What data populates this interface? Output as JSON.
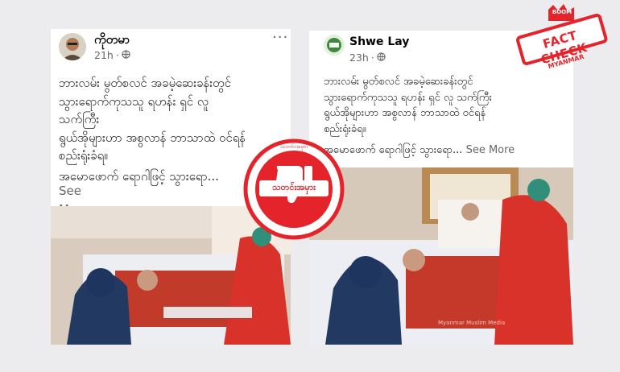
{
  "left_post": {
    "author": "ကိုတမာ",
    "time": "21h",
    "menu_icon": "more-dots-icon",
    "privacy_icon": "globe-icon",
    "text_lines": "ဘားလမ်း မွတ်စလင် အခမဲ့ဆေးခန်းတွင်\nသွားရောက်ကုသသူ ရဟန်း ရှင် လူ\nသက်ကြီး\nရွယ်အိုများဟာ အစွလာန် ဘာသာထဲ ဝင်ရန်\nစည်းရုံးခံရ။",
    "second_para": "အမောဖောက် ရောဂါဖြင့် သွားရော...",
    "see_more": "See\nMore"
  },
  "right_post": {
    "author": "Shwe Lay",
    "time": "23h",
    "privacy_icon": "globe-icon",
    "text_lines": "ဘားလမ်း မွတ်စလင် အခမဲ့ဆေးခန်းတွင်\nသွားရောက်ကုသသူ ရဟန်း ရှင် လူ သက်ကြီး\nရွယ်အိုများဟာ အစွလာန် ဘာသာထဲ ဝင်ရန်\nစည်းရုံးခံရ။",
    "second_para": "အမောဖောက် ရောဂါဖြင့် သွားရော...",
    "see_more": "See More",
    "photo_watermark": "Myanmar Muslim Media"
  },
  "stamp": {
    "label": "သတင်းအမှား",
    "ring_text": "သတင်းအမှား",
    "color": "#e4232b",
    "icon": "thumbs-down-icon"
  },
  "badge": {
    "top": "BOOM",
    "main": "FACT CHECK",
    "bottom": "MYANMAR",
    "color": "#e4232b"
  },
  "colors": {
    "background": "#ececef",
    "card": "#ffffff",
    "muted": "#65676b"
  }
}
